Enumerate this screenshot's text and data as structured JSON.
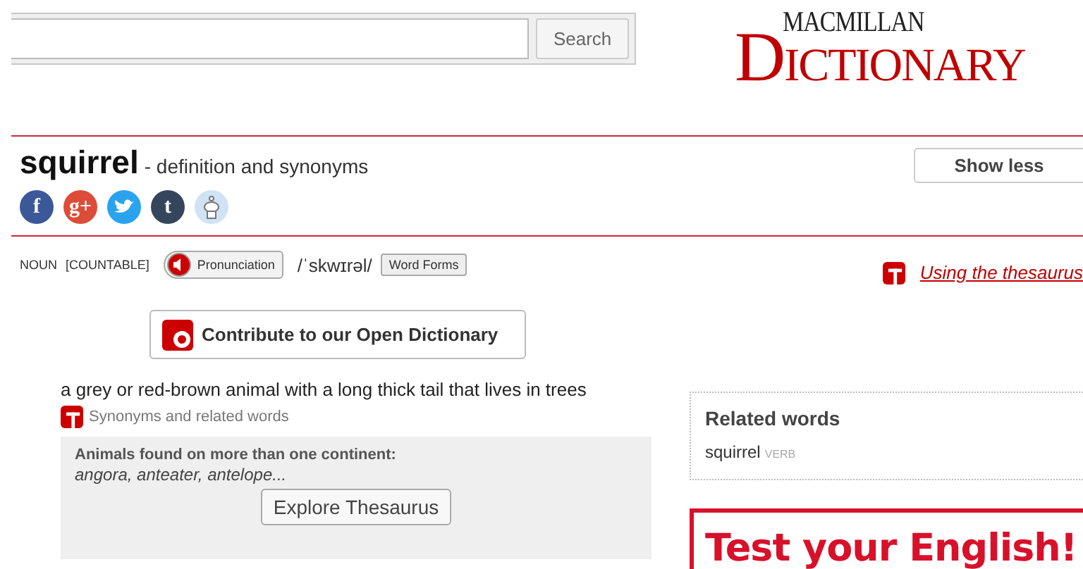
{
  "search": {
    "button": "Search"
  },
  "logo": {
    "top": "MACMILLAN",
    "bottom": "DICTIONARY"
  },
  "entry": {
    "headword": "squirrel",
    "subtitle": "- definition and synonyms",
    "toggle": "Show less",
    "share": [
      {
        "kind": "letter",
        "glyph": "f",
        "color": "#3b5998"
      },
      {
        "kind": "letter",
        "glyph": "g+",
        "color": "#dd4b39"
      },
      {
        "kind": "bird",
        "color": "#2aa3ef"
      },
      {
        "kind": "letter",
        "glyph": "t",
        "color": "#35465c"
      },
      {
        "kind": "robot",
        "color": "#cfe3f5"
      }
    ],
    "pos": "NOUN",
    "grammar": "[COUNTABLE]",
    "pronunciation_button": "Pronunciation",
    "ipa": "/ˈskwɪrəl/",
    "forms_button": "Word Forms",
    "thesaurus_link": "Using the thesaurus"
  },
  "contribute_button": "Contribute to our Open Dictionary",
  "definition": "a grey or red-brown animal with a long thick tail that lives in trees",
  "synonyms_label": "Synonyms and related words",
  "thesaurus_box": {
    "heading": "Animals found on more than one continent:",
    "words": "angora, anteater, antelope...",
    "button": "Explore Thesaurus"
  },
  "related": {
    "title": "Related words",
    "items": [
      {
        "word": "squirrel",
        "pos": "VERB"
      }
    ]
  },
  "promo": {
    "title": "Test your English!"
  }
}
